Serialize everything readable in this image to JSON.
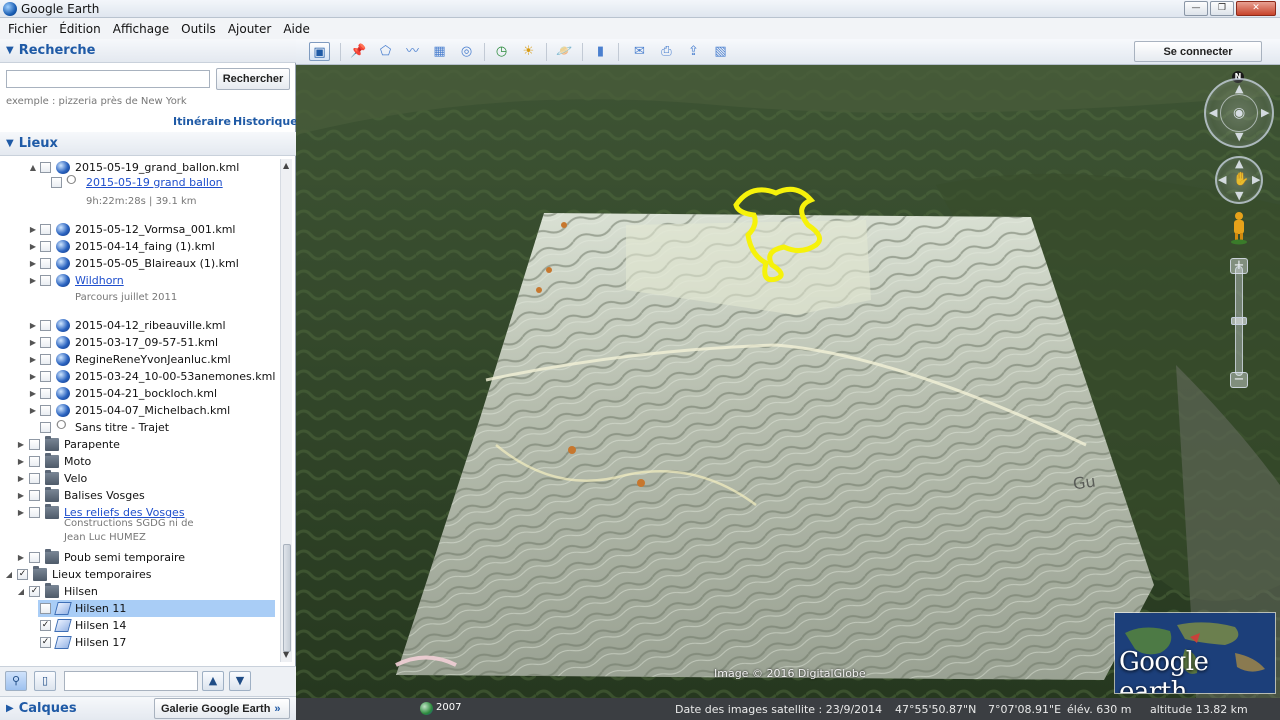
{
  "app": {
    "title": "Google Earth"
  },
  "window_controls": {
    "minimize": "—",
    "maximize": "❐",
    "close": "✕"
  },
  "menu": [
    "Fichier",
    "Édition",
    "Affichage",
    "Outils",
    "Ajouter",
    "Aide"
  ],
  "search": {
    "header": "Recherche",
    "input_value": "",
    "button": "Rechercher",
    "hint": "exemple : pizzeria près de New York",
    "links": [
      "Itinéraire",
      "Historique"
    ]
  },
  "places": {
    "header": "Lieux",
    "items": [
      {
        "label": "2015-05-19_grand_ballon.kml",
        "icon": "kml-globe-icon",
        "expand": "▲",
        "checked": false,
        "link": false
      },
      {
        "label": "2015-05-19 grand ballon",
        "icon": "track-icon",
        "expand": "",
        "checked": false,
        "link": true
      },
      {
        "label": "2015-05-12_Vormsa_001.kml",
        "icon": "kml-globe-icon",
        "expand": "▶",
        "checked": false,
        "link": false
      },
      {
        "label": "2015-04-14_faing (1).kml",
        "icon": "kml-globe-icon",
        "expand": "▶",
        "checked": false,
        "link": false
      },
      {
        "label": "2015-05-05_Blaireaux (1).kml",
        "icon": "kml-globe-icon",
        "expand": "▶",
        "checked": false,
        "link": false
      },
      {
        "label": "Wildhorn",
        "icon": "kml-globe-icon",
        "expand": "▶",
        "checked": false,
        "link": true
      },
      {
        "label": "2015-04-12_ribeauville.kml",
        "icon": "kml-globe-icon",
        "expand": "▶",
        "checked": false,
        "link": false
      },
      {
        "label": "2015-03-17_09-57-51.kml",
        "icon": "kml-globe-icon",
        "expand": "▶",
        "checked": false,
        "link": false
      },
      {
        "label": "RegineReneYvonJeanluc.kml",
        "icon": "kml-globe-icon",
        "expand": "▶",
        "checked": false,
        "link": false
      },
      {
        "label": "2015-03-24_10-00-53anemones.kml",
        "icon": "kml-globe-icon",
        "expand": "▶",
        "checked": false,
        "link": false
      },
      {
        "label": "2015-04-21_bockloch.kml",
        "icon": "kml-globe-icon",
        "expand": "▶",
        "checked": false,
        "link": false
      },
      {
        "label": "2015-04-07_Michelbach.kml",
        "icon": "kml-globe-icon",
        "expand": "▶",
        "checked": false,
        "link": false
      },
      {
        "label": "Sans titre - Trajet",
        "icon": "track-icon",
        "expand": "",
        "checked": false,
        "link": false
      },
      {
        "label": "Parapente",
        "icon": "folder-icon",
        "expand": "▶",
        "checked": false,
        "link": false
      },
      {
        "label": "Moto",
        "icon": "folder-icon",
        "expand": "▶",
        "checked": false,
        "link": false
      },
      {
        "label": "Velo",
        "icon": "folder-icon",
        "expand": "▶",
        "checked": false,
        "link": false
      },
      {
        "label": "Balises Vosges",
        "icon": "folder-icon",
        "expand": "▶",
        "checked": false,
        "link": false
      },
      {
        "label": "Les reliefs des Vosges",
        "icon": "folder-icon",
        "expand": "▶",
        "checked": false,
        "link": true
      },
      {
        "label": "Poub semi temporaire",
        "icon": "folder-icon",
        "expand": "▶",
        "checked": false,
        "link": false
      },
      {
        "label": "Lieux temporaires",
        "icon": "folder-open-icon",
        "expand": "◢",
        "checked": true,
        "link": false
      },
      {
        "label": "Hilsen",
        "icon": "folder-open-icon",
        "expand": "◢",
        "checked": true,
        "link": false
      },
      {
        "label": "Hilsen 11",
        "icon": "overlay-icon",
        "expand": "",
        "checked": false,
        "link": false,
        "selected": true
      },
      {
        "label": "Hilsen 14",
        "icon": "overlay-icon",
        "expand": "",
        "checked": true,
        "link": false
      },
      {
        "label": "Hilsen 17",
        "icon": "overlay-icon",
        "expand": "",
        "checked": true,
        "link": false
      }
    ],
    "descriptions": {
      "grand_ballon": "9h:22m:28s | 39.1 km",
      "wildhorn": "Parcours juillet 2011",
      "reliefs_line1": "Constructions SGDG ni de",
      "reliefs_line2": "Jean Luc HUMEZ"
    }
  },
  "layers": {
    "header": "Calques",
    "gallery_button": "Galerie Google Earth",
    "gallery_chevron": "»"
  },
  "toolbar": {
    "connect_button": "Se connecter"
  },
  "map": {
    "north_label": "N",
    "attribution": "Image © 2016 DigitalGlobe",
    "logo_text": "Google earth",
    "road_label": "Gu"
  },
  "status": {
    "year": "2007",
    "imagery_date": "Date des images satellite : 23/9/2014",
    "latitude": "47°55'50.87\"N",
    "longitude": "7°07'08.91\"E",
    "elevation": "élév.  630 m",
    "altitude": "altitude  13.82 km"
  }
}
